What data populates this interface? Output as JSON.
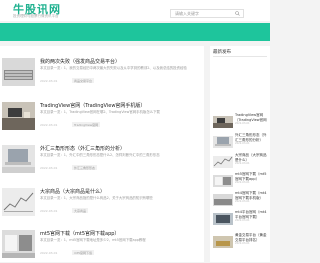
{
  "header": {
    "logo": "牛股讯网",
    "logo_sub": "投资理财与股票行情资讯平台",
    "search_placeholder": "请输入关键字"
  },
  "articles": [
    {
      "title": "我的两次失败（强发商品交易平台）",
      "desc": "本文目录一览：1、我的交易经历中两次最大的失败以及从中学到的教训2、以及我总结的投资经验",
      "meta": "2022-03-01",
      "tag": "商品交易平台",
      "thumb": "keyboard"
    },
    {
      "title": "TradingView官网（TradingView官网手机版）",
      "desc": "本文目录一览：1、TradingView官网在哪2、TradingView官网手机版怎么下载",
      "meta": "2022-03-01",
      "tag": "TradingView官网",
      "thumb": "desk"
    },
    {
      "title": "外汇三角形形态（外汇三角形的分析）",
      "desc": "本文目录一览：1、外汇中的三角形形态是什么2、怎样判断外汇中的三角形形态",
      "meta": "2022-03-01",
      "tag": "外汇三角形形态",
      "thumb": "laptop"
    },
    {
      "title": "大宗商品（大宗商品是什么）",
      "desc": "本文目录一览：1、大宗商品指的是什么商品2、关于大宗商品的知识有哪些",
      "meta": "2022-03-01",
      "tag": "大宗商品",
      "thumb": "chart"
    },
    {
      "title": "mt5官网下载（mt5官网下载app）",
      "desc": "本文目录一览：1、mt5官网下载地址是多少2、mt5官网下载app教程",
      "meta": "2022-03-01",
      "tag": "mt5官网下载",
      "thumb": "office"
    }
  ],
  "sidebar": {
    "title": "最新发布",
    "items": [
      {
        "text": "TradingView官网（TradingView官网手机版）",
        "date": "2022-03-01",
        "thumb": "desk"
      },
      {
        "text": "外汇三角形形态（外汇三角形的分析）",
        "date": "2022-03-01",
        "thumb": "laptop"
      },
      {
        "text": "大宗商品（大宗商品是什么）",
        "date": "2022-03-01",
        "thumb": "chart"
      },
      {
        "text": "mt5官网下载（mt5官网下载app）",
        "date": "2022-03-01",
        "thumb": "office"
      },
      {
        "text": "mt4官网下载（mt4官网下载手机版）",
        "date": "2022-03-01",
        "thumb": "keyboard"
      },
      {
        "text": "mt4平台官网（mt4平台官网下载）",
        "date": "2022-03-01",
        "thumb": "screen"
      },
      {
        "text": "黄金交易平台（黄金交易平台排名）",
        "date": "2022-03-01",
        "thumb": "gold"
      }
    ]
  },
  "colors": {
    "accent": "#1ec59c",
    "logo": "#1fb18f"
  }
}
